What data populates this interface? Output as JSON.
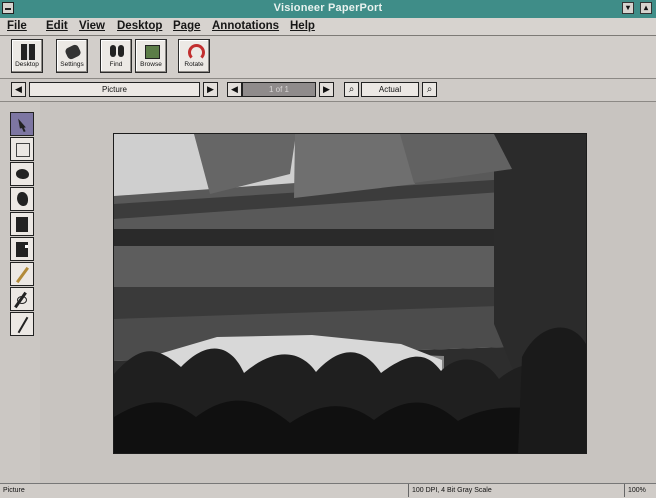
{
  "window": {
    "title": "Visioneer PaperPort"
  },
  "menu": {
    "items": [
      "File",
      "Edit",
      "View",
      "Desktop",
      "Page",
      "Annotations",
      "Help"
    ]
  },
  "toolbar": {
    "buttons": [
      {
        "label": "Desktop",
        "icon": "desktop-icon"
      },
      {
        "label": "Settings",
        "icon": "settings-icon"
      },
      {
        "label": "Find",
        "icon": "find-icon"
      },
      {
        "label": "Browse",
        "icon": "browse-icon"
      },
      {
        "label": "Rotate",
        "icon": "rotate-icon"
      }
    ]
  },
  "navigation": {
    "view_mode": "Picture",
    "page_indicator": "1 of 1",
    "zoom_mode": "Actual"
  },
  "tools": [
    {
      "name": "pointer-tool",
      "icon": "pointer-icon"
    },
    {
      "name": "rectangle-tool",
      "icon": "rectangle-icon"
    },
    {
      "name": "hand-tool",
      "icon": "hand-icon"
    },
    {
      "name": "highlight-tool",
      "icon": "highlight-icon"
    },
    {
      "name": "note-tool",
      "icon": "note-icon"
    },
    {
      "name": "sticky-note-tool",
      "icon": "sticky-note-icon"
    },
    {
      "name": "pen-tool",
      "icon": "pen-icon"
    },
    {
      "name": "marker-tool",
      "icon": "marker-icon"
    },
    {
      "name": "line-tool",
      "icon": "line-icon"
    }
  ],
  "document": {
    "content_type": "Picture"
  },
  "status": {
    "left": "Picture",
    "middle": "100 DPI, 4 Bit Gray Scale",
    "right": "100%"
  }
}
